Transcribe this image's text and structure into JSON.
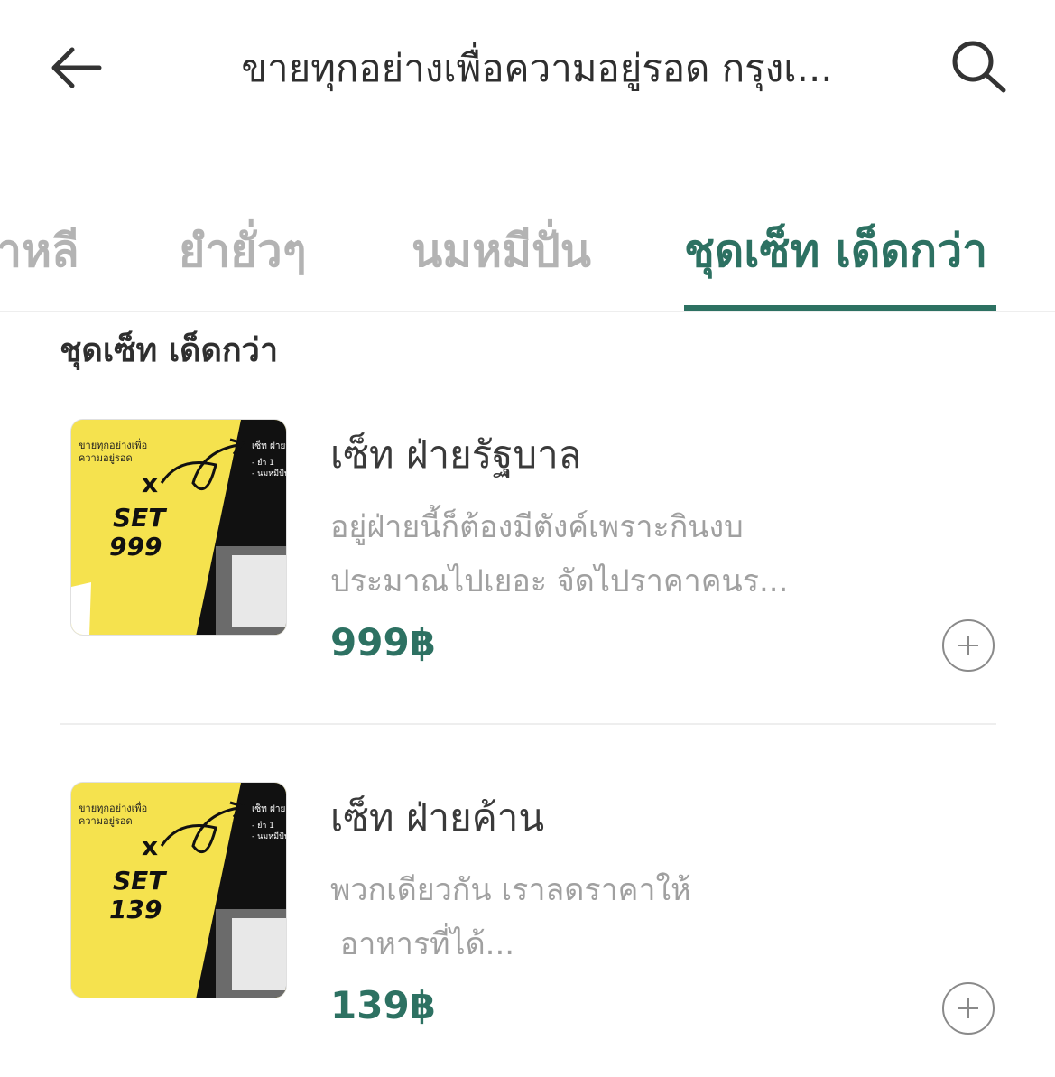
{
  "header": {
    "back_icon": "arrow-left-icon",
    "title": "ขายทุกอย่างเพื่อความอยู่รอด กรุงเ...",
    "search_icon": "search-icon"
  },
  "tabs": [
    {
      "label": "าหลี",
      "active": false
    },
    {
      "label": "ยำยั่วๆ",
      "active": false
    },
    {
      "label": "นมหมีปั่น",
      "active": false
    },
    {
      "label": "ชุดเซ็ท เด็ดกว่า",
      "active": true
    }
  ],
  "section": {
    "title": "ชุดเซ็ท เด็ดกว่า"
  },
  "items": [
    {
      "name": "เซ็ท ฝ่ายรัฐบาล",
      "desc_line1": "อยู่ฝ่ายนี้ก็ต้องมีตังค์เพราะกินงบ",
      "desc_line2": "ประมาณไปเยอะ จัดไปราคาคนร...",
      "price": "999฿",
      "thumb": {
        "brand": "ขายทุกอย่างเพื่อ",
        "brand2": "ความอยู่รอด",
        "set_label": "SET",
        "set_number": "999",
        "right_title": "เซ็ท ฝ่ายรัฐบ",
        "bullet1": "- ยำ 1",
        "bullet2": "- นมหมีปั่น"
      }
    },
    {
      "name": "เซ็ท ฝ่ายค้าน",
      "desc_line1": "พวกเดียวกัน เราลดราคาให้",
      "desc_line2": " อาหารที่ได้...",
      "price": "139฿",
      "thumb": {
        "brand": "ขายทุกอย่างเพื่อ",
        "brand2": "ความอยู่รอด",
        "set_label": "SET",
        "set_number": "139",
        "right_title": "เซ็ท ฝ่ายค้าน",
        "bullet1": "- ยำ 1",
        "bullet2": "- นมหมีปั่น"
      }
    }
  ],
  "colors": {
    "accent": "#2d7162",
    "muted": "#b3b3b3",
    "thumb_yellow": "#f5e24e"
  }
}
